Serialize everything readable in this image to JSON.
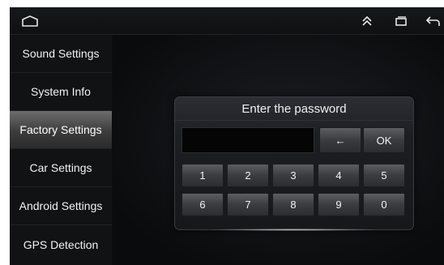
{
  "topbar": {
    "home_icon": "home-outline-icon",
    "icons": [
      "double-chevron-up-icon",
      "recent-apps-icon",
      "back-arrow-icon"
    ]
  },
  "sidebar": {
    "items": [
      {
        "label": "Sound Settings"
      },
      {
        "label": "System Info"
      },
      {
        "label": "Factory Settings",
        "active": true
      },
      {
        "label": "Car Settings"
      },
      {
        "label": "Android Settings"
      },
      {
        "label": "GPS Detection"
      }
    ]
  },
  "dialog": {
    "title": "Enter the password",
    "password_value": "",
    "backspace_label": "←",
    "ok_label": "OK",
    "keys": [
      "1",
      "2",
      "3",
      "4",
      "5",
      "6",
      "7",
      "8",
      "9",
      "0"
    ]
  },
  "colors": {
    "background": "#0d0e10",
    "active_item": "#5a5a5a",
    "text": "#f2f2f2"
  }
}
